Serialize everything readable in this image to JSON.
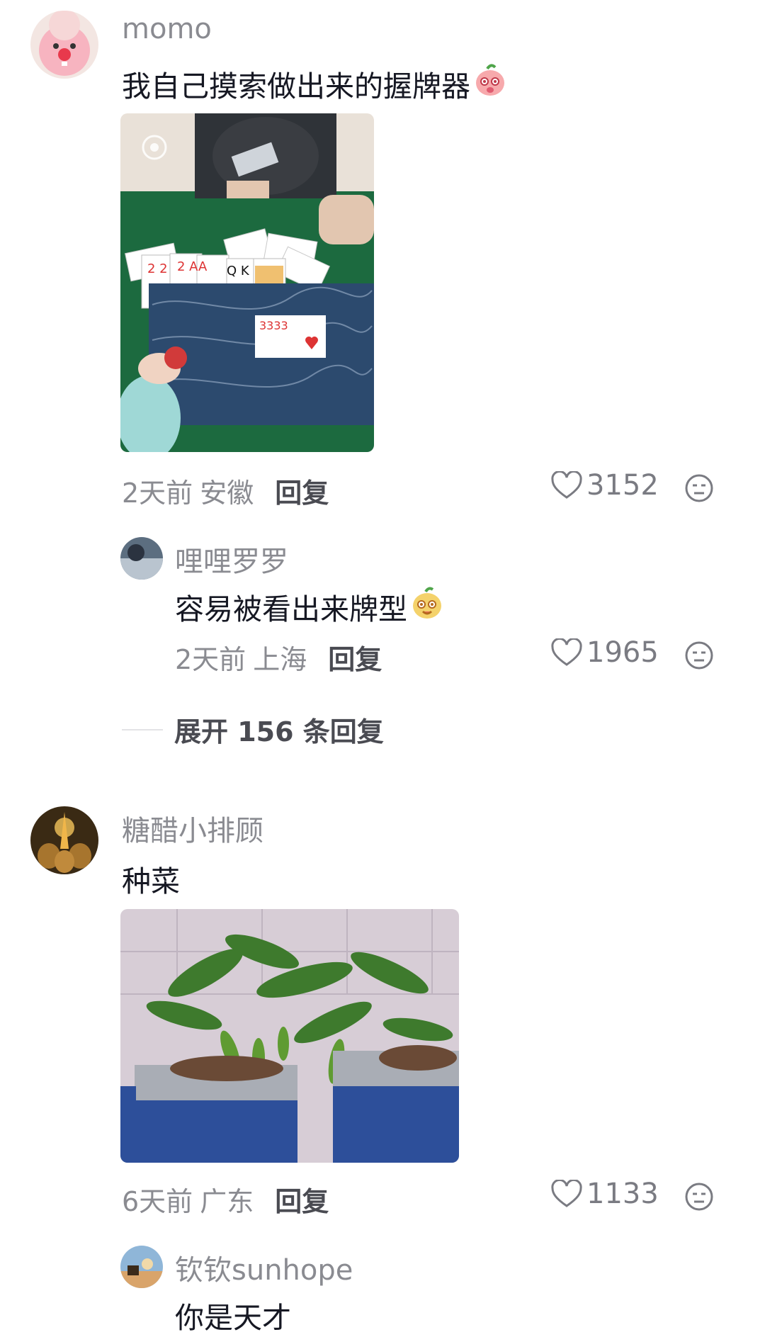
{
  "comments": [
    {
      "username": "momo",
      "text": "我自己摸索做出来的握牌器",
      "emoji_icon": "peach-face-emoji",
      "time": "2天前",
      "location": "安徽",
      "reply_label": "回复",
      "likes": "3152",
      "reply": {
        "username": "哩哩罗罗",
        "text": "容易被看出来牌型",
        "emoji_icon": "potato-face-emoji",
        "time": "2天前",
        "location": "上海",
        "reply_label": "回复",
        "likes": "1965"
      },
      "expand_label": "展开 156 条回复"
    },
    {
      "username": "糖醋小排顾",
      "text": "种菜",
      "time": "6天前",
      "location": "广东",
      "reply_label": "回复",
      "likes": "1133",
      "reply": {
        "username": "钦钦sunhope",
        "text": "你是天才"
      }
    }
  ]
}
